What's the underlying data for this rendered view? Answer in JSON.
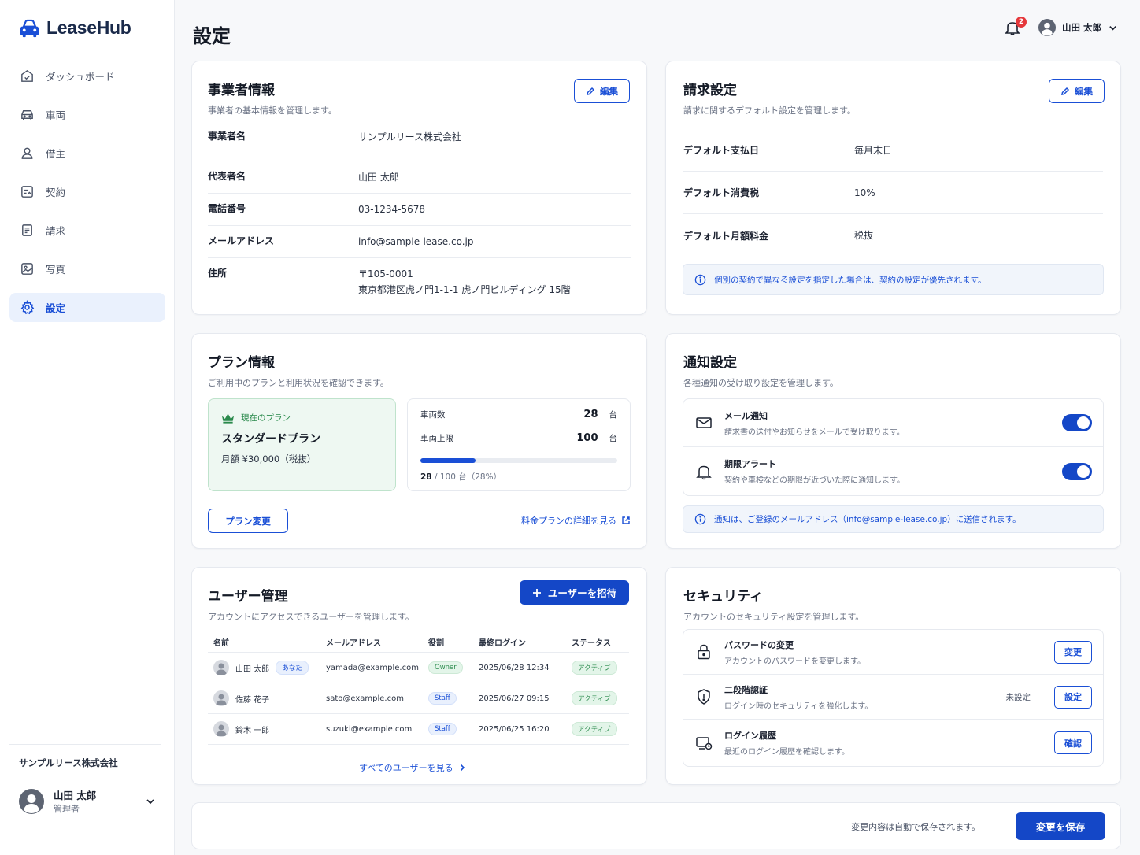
{
  "app": {
    "name": "LeaseHub"
  },
  "sidebar": {
    "items": [
      {
        "label": "ダッシュボード",
        "icon": "dashboard-icon"
      },
      {
        "label": "車両",
        "icon": "car-icon"
      },
      {
        "label": "借主",
        "icon": "person-icon"
      },
      {
        "label": "契約",
        "icon": "contract-icon"
      },
      {
        "label": "請求",
        "icon": "invoice-icon"
      },
      {
        "label": "写真",
        "icon": "photo-icon"
      },
      {
        "label": "設定",
        "icon": "gear-icon",
        "active": true
      }
    ],
    "company": "サンプルリース株式会社",
    "user": {
      "name": "山田 太郎",
      "role": "管理者"
    }
  },
  "header": {
    "title": "設定",
    "notification_count": "2",
    "user_name": "山田 太郎"
  },
  "business": {
    "title": "事業者情報",
    "subtitle": "事業者の基本情報を管理します。",
    "edit_label": "編集",
    "rows": [
      {
        "key": "事業者名",
        "value": "サンプルリース株式会社"
      },
      {
        "key": "代表者名",
        "value": "山田 太郎"
      },
      {
        "key": "電話番号",
        "value": "03-1234-5678"
      },
      {
        "key": "メールアドレス",
        "value": "info@sample-lease.co.jp"
      },
      {
        "key": "住所",
        "value": "〒105-0001",
        "value2": "東京都港区虎ノ門1-1-1 虎ノ門ビルディング 15階"
      }
    ]
  },
  "billing": {
    "title": "請求設定",
    "subtitle": "請求に関するデフォルト設定を管理します。",
    "edit_label": "編集",
    "rows": [
      {
        "key": "デフォルト支払日",
        "value": "毎月末日"
      },
      {
        "key": "デフォルト消費税",
        "value": "10%"
      },
      {
        "key": "デフォルト月額料金",
        "value": "税抜"
      }
    ],
    "info": "個別の契約で異なる設定を指定した場合は、契約の設定が優先されます。"
  },
  "plan": {
    "title": "プラン情報",
    "subtitle": "ご利用中のプランと利用状況を確認できます。",
    "current_label": "現在のプラン",
    "plan_name": "スタンダードプラン",
    "price": "月額 ¥30,000（税抜）",
    "vehicles_label": "車両数",
    "vehicles_count": "28",
    "limit_label": "車両上限",
    "limit_count": "100",
    "unit": "台",
    "usage_fraction": 0.28,
    "usage_text_a": "28",
    "usage_text_b": "/ 100 台（28%）",
    "change_button": "プラン変更",
    "details_link": "料金プランの詳細を見る"
  },
  "notifications": {
    "title": "通知設定",
    "subtitle": "各種通知の受け取り設定を管理します。",
    "items": [
      {
        "title": "メール通知",
        "desc": "請求書の送付やお知らせをメールで受け取ります。",
        "enabled": true
      },
      {
        "title": "期限アラート",
        "desc": "契約や車検などの期限が近づいた際に通知します。",
        "enabled": true
      }
    ],
    "info": "通知は、ご登録のメールアドレス（info@sample-lease.co.jp）に送信されます。"
  },
  "users": {
    "title": "ユーザー管理",
    "subtitle": "アカウントにアクセスできるユーザーを管理します。",
    "invite_button": "ユーザーを招待",
    "columns": [
      "名前",
      "メールアドレス",
      "役割",
      "最終ログイン",
      "ステータス"
    ],
    "rows": [
      {
        "name": "山田 太郎",
        "you": "あなた",
        "email": "yamada@example.com",
        "role": "Owner",
        "last_login": "2025/06/28 12:34",
        "status": "アクティブ"
      },
      {
        "name": "佐藤 花子",
        "email": "sato@example.com",
        "role": "Staff",
        "last_login": "2025/06/27 09:15",
        "status": "アクティブ"
      },
      {
        "name": "鈴木 一郎",
        "email": "suzuki@example.com",
        "role": "Staff",
        "last_login": "2025/06/25 16:20",
        "status": "アクティブ"
      }
    ],
    "view_all": "すべてのユーザーを見る"
  },
  "security": {
    "title": "セキュリティ",
    "subtitle": "アカウントのセキュリティ設定を管理します。",
    "items": [
      {
        "title": "パスワードの変更",
        "desc": "アカウントのパスワードを変更します。",
        "status": "",
        "button": "変更"
      },
      {
        "title": "二段階認証",
        "desc": "ログイン時のセキュリティを強化します。",
        "status": "未設定",
        "button": "設定"
      },
      {
        "title": "ログイン履歴",
        "desc": "最近のログイン履歴を確認します。",
        "status": "",
        "button": "確認"
      }
    ]
  },
  "footer": {
    "autosave_note": "変更内容は自動で保存されます。",
    "save_button": "変更を保存"
  },
  "colors": {
    "accent": "#1447c7",
    "active_bg": "#eaf1fd",
    "success": "#2a8a4c",
    "alert": "#e5383b"
  }
}
